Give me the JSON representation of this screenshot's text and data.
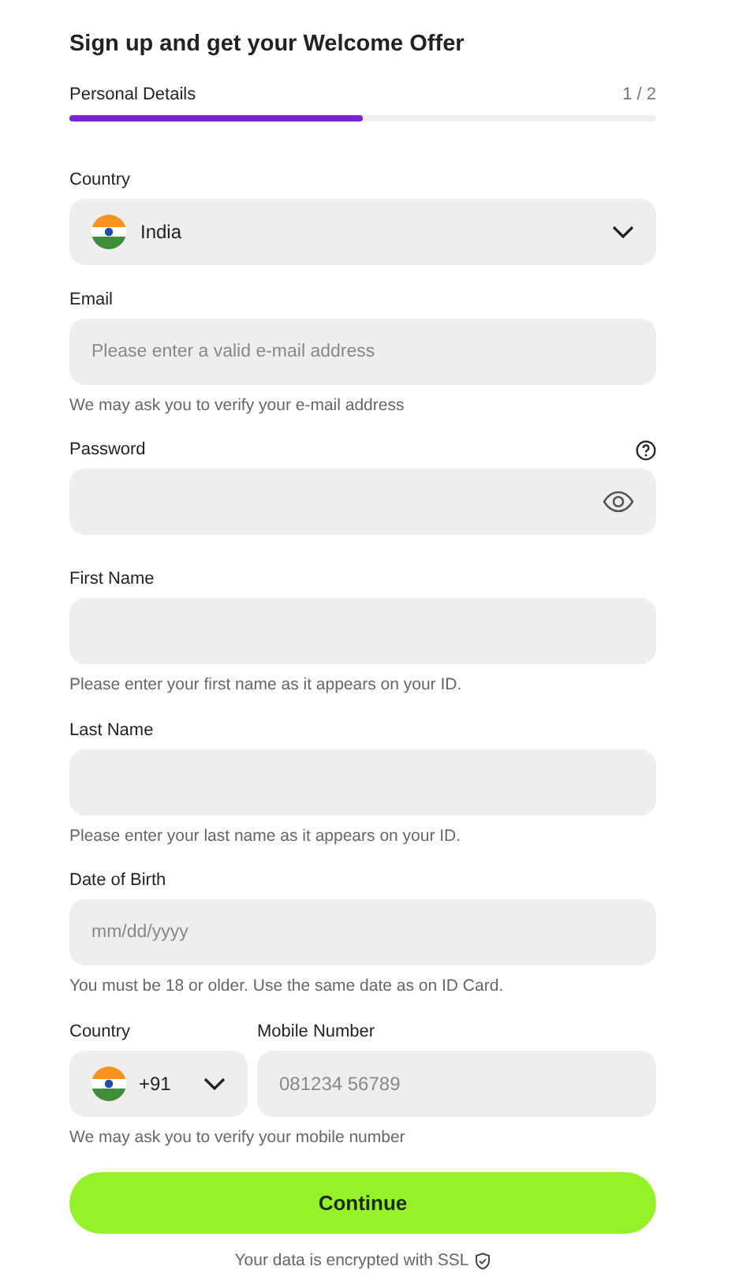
{
  "title": "Sign up and get your Welcome Offer",
  "progress": {
    "label": "Personal Details",
    "step": "1 / 2",
    "level": 0.5
  },
  "fields": [
    {
      "kind": "select",
      "label": "Country",
      "value": "India"
    },
    {
      "kind": "text",
      "label": "Email",
      "placeholder": "Please enter a valid e-mail address",
      "hint": "We may ask you to verify your e-mail address"
    },
    {
      "kind": "password",
      "label": "Password"
    },
    {
      "kind": "text",
      "label": "First Name",
      "hint": "Please enter your first name as it appears on your ID."
    },
    {
      "kind": "text",
      "label": "Last Name",
      "hint": "Please enter your last name as it appears on your ID."
    },
    {
      "kind": "text",
      "label": "Date of Birth",
      "placeholder": "mm/dd/yyyy",
      "hint": "You must be 18 or older. Use the same date as on ID Card."
    },
    {
      "kind": "phone",
      "label": "Country",
      "code": "+91",
      "label_2": "Mobile Number",
      "placeholder": "081234 56789",
      "hint": "We may ask you to verify your mobile number"
    }
  ],
  "button": "Continue",
  "footer": "Your data is encrypted with SSL"
}
